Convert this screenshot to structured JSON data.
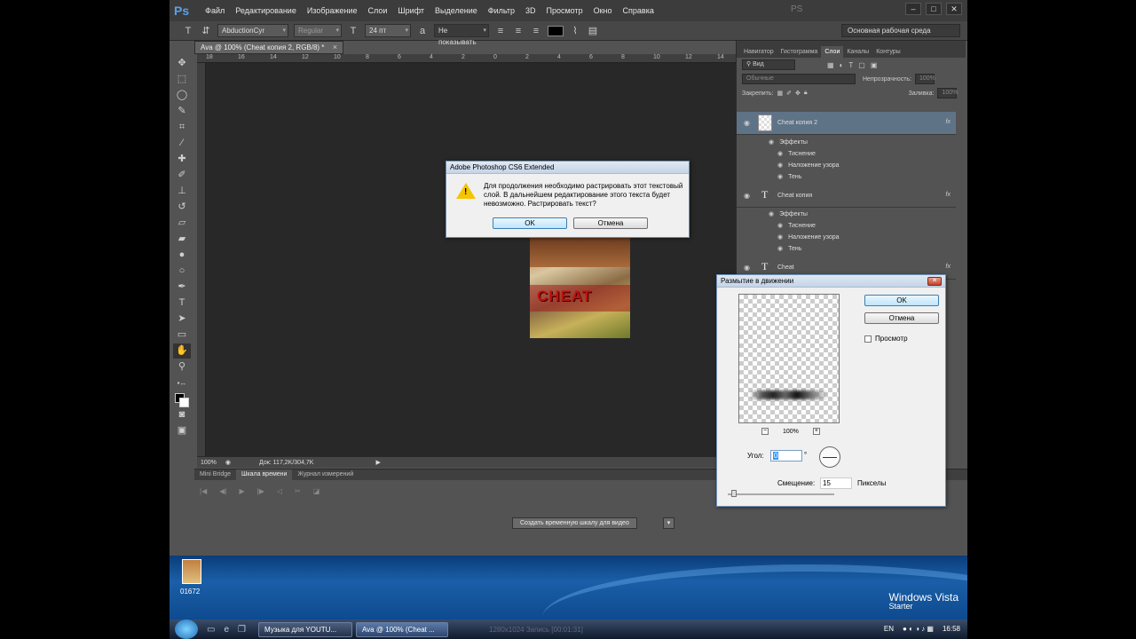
{
  "menubar": {
    "logo": "Ps",
    "items": [
      "Файл",
      "Редактирование",
      "Изображение",
      "Слои",
      "Шрифт",
      "Выделение",
      "Фильтр",
      "3D",
      "Просмотр",
      "Окно",
      "Справка"
    ],
    "center_logo": "PS"
  },
  "options": {
    "font_family": "AbductionCyr",
    "font_style": "Regular",
    "font_size": "24 пт",
    "aa": "Не показывать",
    "workspace": "Основная рабочая среда"
  },
  "document": {
    "tab_title": "Ava @ 100% (Cheat копия 2, RGB/8) *",
    "image_text": "CHEAT",
    "zoom": "100%",
    "doc_info": "Док: 117,2K/304,7K"
  },
  "ruler_h": [
    "18",
    "16",
    "14",
    "12",
    "10",
    "8",
    "6",
    "4",
    "2",
    "0",
    "2",
    "4",
    "6",
    "8",
    "10",
    "12",
    "14",
    "16"
  ],
  "bottom_panel": {
    "tabs": [
      "Mini Bridge",
      "Шкала времени",
      "Журнал измерений"
    ],
    "create_button": "Создать временную шкалу для видео"
  },
  "layers_panel": {
    "tabs": [
      "Навигатор",
      "Гистограмма",
      "Слои",
      "Каналы",
      "Контуры"
    ],
    "kind_filter": "Вид",
    "blend_mode": "Обычные",
    "opacity_label": "Непрозрачность:",
    "opacity_value": "100%",
    "lock_label": "Закрепить:",
    "fill_label": "Заливка:",
    "fill_value": "100%",
    "layers": [
      {
        "name": "Cheat копия 2",
        "active": true,
        "effects_label": "Эффекты",
        "effects": [
          "Тиснение",
          "Наложение узора",
          "Тень"
        ]
      },
      {
        "name": "Cheat копия",
        "active": false,
        "effects_label": "Эффекты",
        "effects": [
          "Тиснение",
          "Наложение узора",
          "Тень"
        ]
      },
      {
        "name": "Cheat",
        "active": false
      }
    ],
    "fx_label": "fx"
  },
  "rasterize_dialog": {
    "title": "Adobe Photoshop CS6 Extended",
    "message": "Для продолжения необходимо растрировать этот текстовый слой.  В дальнейшем редактирование этого текста будет невозможно.  Растрировать текст?",
    "ok": "OK",
    "cancel": "Отмена"
  },
  "motion_blur_dialog": {
    "title": "Размытие в движении",
    "ok": "OK",
    "cancel": "Отмена",
    "preview_label": "Просмотр",
    "zoom": "100%",
    "angle_label": "Угол:",
    "angle_value": "0",
    "degree": "°",
    "offset_label": "Смещение:",
    "offset_value": "15",
    "offset_unit": "Пикселы"
  },
  "desktop": {
    "icon_label": "01672",
    "os_name": "Windows Vista",
    "os_edition": "Starter"
  },
  "taskbar": {
    "tasks": [
      "Музыка для YOUTU...",
      "Ava @ 100% (Cheat ..."
    ],
    "recording": "1280x1024   Запись [00:01:31]",
    "lang": "EN",
    "clock": "16:58"
  }
}
